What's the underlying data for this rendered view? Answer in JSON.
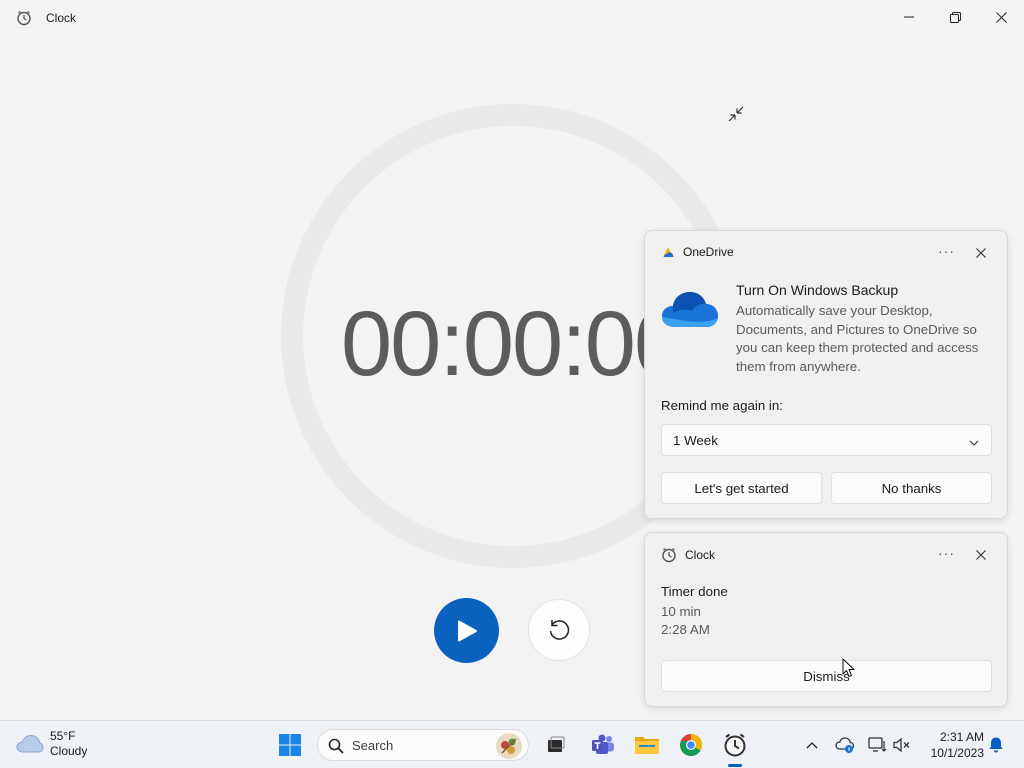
{
  "window": {
    "title": "Clock",
    "timer_display": "00:00:00"
  },
  "notifications": {
    "onedrive": {
      "app_name": "OneDrive",
      "more": "···",
      "title": "Turn On Windows Backup",
      "body": "Automatically save your Desktop, Documents, and Pictures to OneDrive so you can keep them protected and access them from anywhere.",
      "remind_label": "Remind me again in:",
      "remind_value": "1 Week",
      "primary_button": "Let's get started",
      "secondary_button": "No thanks"
    },
    "clock": {
      "app_name": "Clock",
      "more": "···",
      "title": "Timer done",
      "line1": "10 min",
      "line2": "2:28 AM",
      "dismiss_button": "Dismiss"
    }
  },
  "taskbar": {
    "weather_temp": "55°F",
    "weather_desc": "Cloudy",
    "search_label": "Search",
    "time": "2:31 AM",
    "date": "10/1/2023"
  },
  "colors": {
    "accent": "#0b62be",
    "timer_text": "#5c5c5c",
    "background": "#f3f3f3"
  }
}
